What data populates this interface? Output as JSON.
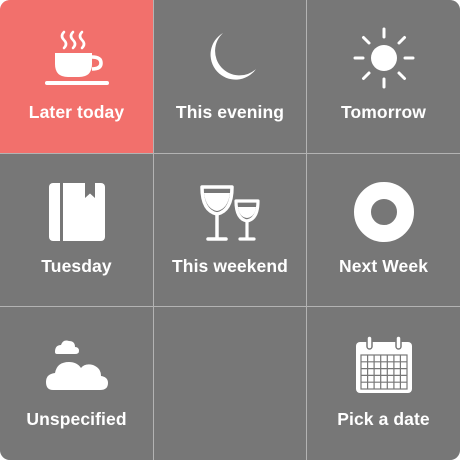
{
  "options": [
    {
      "label": "Later today",
      "icon": "coffee-cup-icon",
      "selected": true
    },
    {
      "label": "This evening",
      "icon": "moon-icon",
      "selected": false
    },
    {
      "label": "Tomorrow",
      "icon": "sun-icon",
      "selected": false
    },
    {
      "label": "Tuesday",
      "icon": "notebook-icon",
      "selected": false
    },
    {
      "label": "This weekend",
      "icon": "wine-glasses-icon",
      "selected": false
    },
    {
      "label": "Next Week",
      "icon": "ring-icon",
      "selected": false
    },
    {
      "label": "Unspecified",
      "icon": "cloud-icon",
      "selected": false
    },
    {
      "label": "Pick a date",
      "icon": "calendar-icon",
      "selected": false
    }
  ],
  "colors": {
    "selected_tile": "#f2706c",
    "tile": "#777777",
    "divider": "#b3b3b3",
    "foreground": "#ffffff"
  }
}
